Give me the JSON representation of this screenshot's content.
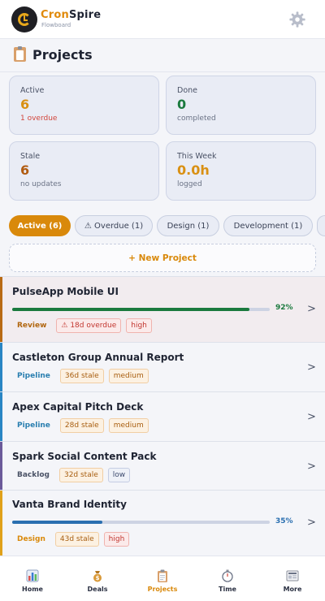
{
  "header": {
    "brand_part1": "Cron",
    "brand_part2": "Spire",
    "brand_sub": "Flowboard",
    "settings_icon": "gear-icon"
  },
  "page": {
    "title": "Projects",
    "title_icon": "clipboard-icon"
  },
  "stats": [
    {
      "label": "Active",
      "value": "6",
      "sub": "1 overdue",
      "value_color": "#d99013",
      "sub_color": "#d2453b"
    },
    {
      "label": "Done",
      "value": "0",
      "sub": "completed",
      "value_color": "#1b7a3e"
    },
    {
      "label": "Stale",
      "value": "6",
      "sub": "no updates",
      "value_color": "#b15c12"
    },
    {
      "label": "This Week",
      "value": "0.0h",
      "sub": "logged",
      "value_color": "#d99013"
    }
  ],
  "filters": [
    {
      "label": "Active (6)",
      "active": true
    },
    {
      "label": "⚠ Overdue (1)",
      "active": false
    },
    {
      "label": "Design (1)",
      "active": false
    },
    {
      "label": "Development (1)",
      "active": false
    }
  ],
  "new_project_label": "+ New Project",
  "projects": [
    {
      "name": "PulseApp Mobile UI",
      "stage": "Review",
      "stage_color": "#b1660f",
      "accent": "#b86a14",
      "progress": 92,
      "progress_label": "92%",
      "progress_color": "#1b7a3e",
      "tags": [
        {
          "text": "⚠ 18d overdue",
          "kind": "overdue"
        },
        {
          "text": "high",
          "kind": "high"
        }
      ]
    },
    {
      "name": "Castleton Group Annual Report",
      "stage": "Pipeline",
      "stage_color": "#2a7fb0",
      "accent": "#2a86c4",
      "tags": [
        {
          "text": "36d stale",
          "kind": "stale"
        },
        {
          "text": "medium",
          "kind": "medium"
        }
      ]
    },
    {
      "name": "Apex Capital Pitch Deck",
      "stage": "Pipeline",
      "stage_color": "#2a7fb0",
      "accent": "#2a86c4",
      "tags": [
        {
          "text": "28d stale",
          "kind": "stale"
        },
        {
          "text": "medium",
          "kind": "medium"
        }
      ]
    },
    {
      "name": "Spark Social Content Pack",
      "stage": "Backlog",
      "stage_color": "#4a5266",
      "accent": "#6b5a9a",
      "tags": [
        {
          "text": "32d stale",
          "kind": "stale"
        },
        {
          "text": "low",
          "kind": "low"
        }
      ]
    },
    {
      "name": "Vanta Brand Identity",
      "stage": "Design",
      "stage_color": "#d9890b",
      "accent": "#e0a11a",
      "progress": 35,
      "progress_label": "35%",
      "progress_color": "#2a6fb0",
      "tags": [
        {
          "text": "43d stale",
          "kind": "stale"
        },
        {
          "text": "high",
          "kind": "high"
        }
      ]
    }
  ],
  "nav": [
    {
      "label": "Home",
      "icon": "bar-chart-icon"
    },
    {
      "label": "Deals",
      "icon": "money-bag-icon"
    },
    {
      "label": "Projects",
      "icon": "clipboard-icon",
      "active": true
    },
    {
      "label": "Time",
      "icon": "stopwatch-icon"
    },
    {
      "label": "More",
      "icon": "newspaper-icon"
    }
  ]
}
